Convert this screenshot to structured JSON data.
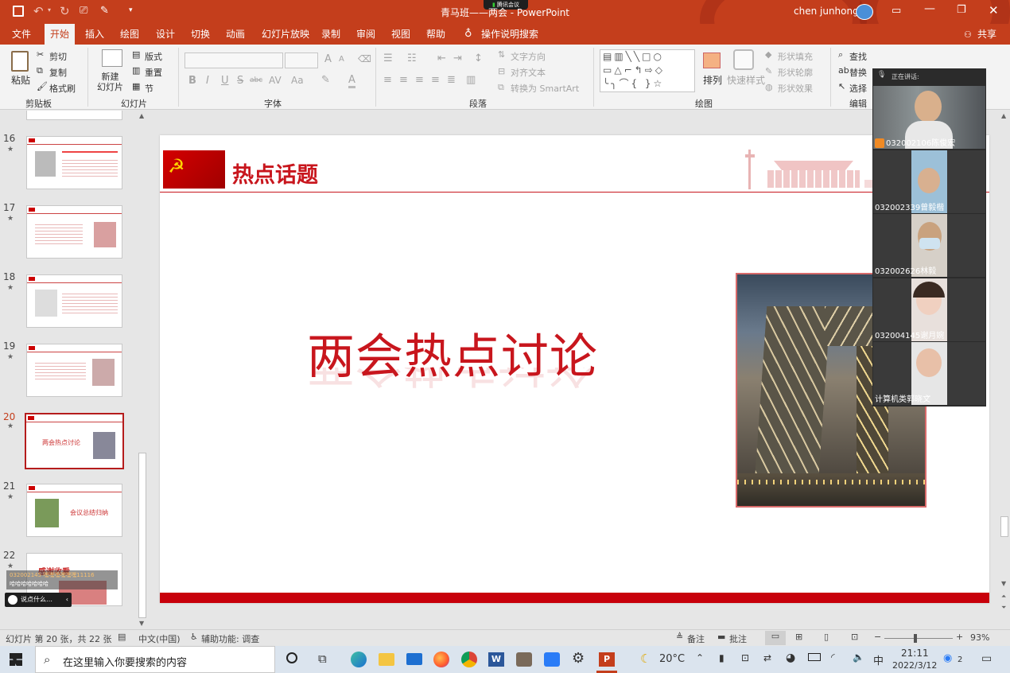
{
  "window": {
    "title": "青马班——两会 - PowerPoint",
    "user": "chen junhong",
    "meeting_badge": "腾讯会议"
  },
  "tabs": [
    "文件",
    "开始",
    "插入",
    "绘图",
    "设计",
    "切换",
    "动画",
    "幻灯片放映",
    "录制",
    "审阅",
    "视图",
    "帮助"
  ],
  "active_tab": "开始",
  "tell_me": "操作说明搜索",
  "share": "共享",
  "ribbon": {
    "clipboard": {
      "paste": "粘贴",
      "cut": "剪切",
      "copy": "复制",
      "format_painter": "格式刷",
      "group": "剪贴板"
    },
    "slides": {
      "new_slide": "新建\n幻灯片",
      "layout": "版式",
      "reset": "重置",
      "section": "节",
      "group": "幻灯片"
    },
    "font": {
      "group": "字体",
      "bold": "B",
      "italic": "I",
      "underline": "U",
      "strike": "S",
      "shadow": "abc",
      "spacing": "AV",
      "case": "Aa",
      "grow": "A",
      "shrink": "A"
    },
    "paragraph": {
      "group": "段落",
      "text_direction": "文字方向",
      "align_text": "对齐文本",
      "smartart": "转换为 SmartArt"
    },
    "drawing": {
      "group": "绘图",
      "arrange": "排列",
      "quick_styles": "快速样式",
      "fill": "形状填充",
      "outline": "形状轮廓",
      "effects": "形状效果"
    },
    "editing": {
      "group": "编辑",
      "find": "查找",
      "replace": "替换",
      "select": "选择"
    }
  },
  "thumbnails": [
    {
      "num": "16",
      "text": "两会热点话题"
    },
    {
      "num": "17",
      "text": "两会热点话题"
    },
    {
      "num": "18",
      "text": "两会热点话题"
    },
    {
      "num": "19",
      "text": "两会热点话题"
    },
    {
      "num": "20",
      "text": "两会热点讨论",
      "selected": true
    },
    {
      "num": "21",
      "text": "会议总结归纳"
    },
    {
      "num": "22",
      "text": "感谢收看"
    }
  ],
  "chat_toast": {
    "line1": "032002145 嘿嘿嘿嘿嘿嘿11116",
    "line2": "哈哈哈哈哈哈哈",
    "input": "说点什么…"
  },
  "slide": {
    "header_title": "热点话题",
    "main_title": "两会热点讨论"
  },
  "meeting": {
    "speaking": "正在讲话:",
    "participants": [
      "032002106陈俊宏",
      "032002339曾毅楷",
      "032002626林毅",
      "032004145谢月婉",
      "计算机类郭晓文"
    ]
  },
  "status": {
    "slide_info": "幻灯片 第 20 张，共 22 张",
    "language": "中文(中国)",
    "accessibility": "辅助功能: 调查",
    "notes": "备注",
    "comments": "批注",
    "zoom": "93%"
  },
  "taskbar": {
    "search_placeholder": "在这里输入你要搜索的内容",
    "weather": "20°C",
    "ime": "中",
    "time": "21:11",
    "date": "2022/3/12",
    "notifications": "2"
  }
}
